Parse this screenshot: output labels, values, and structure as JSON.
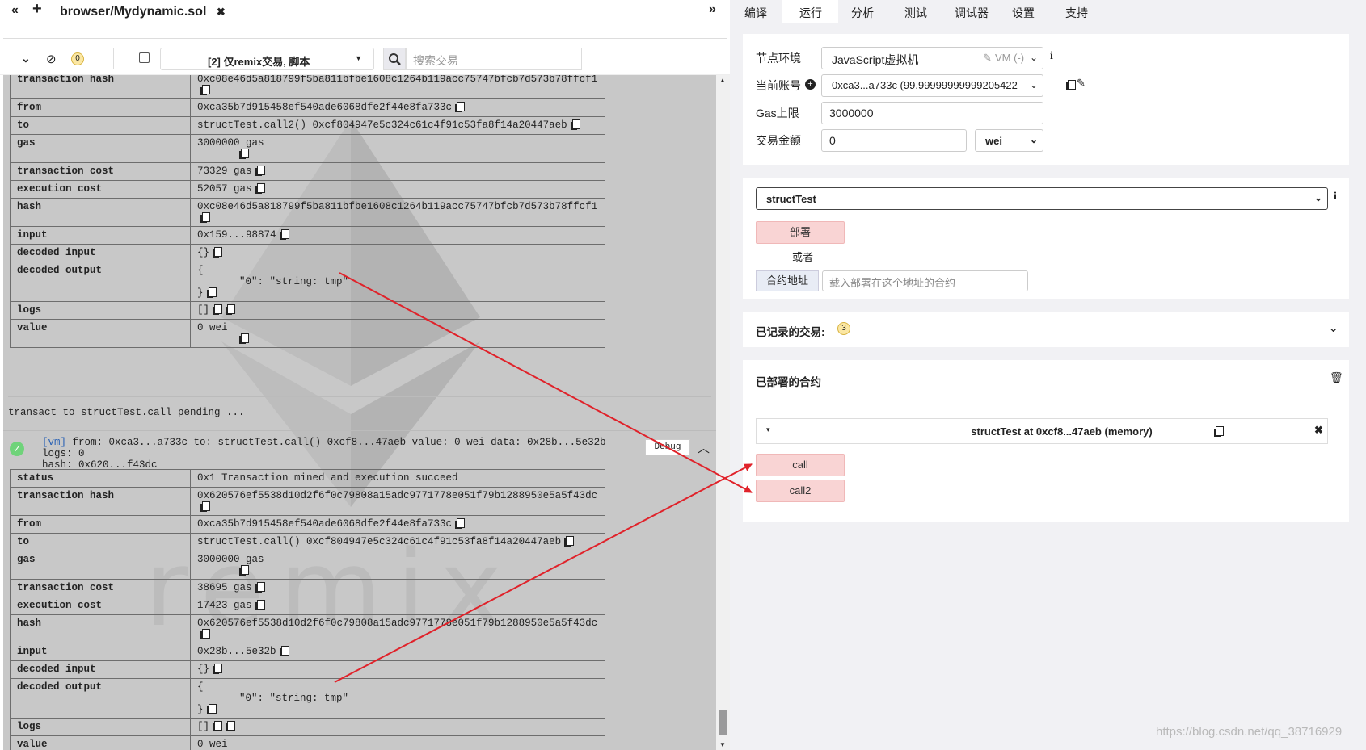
{
  "editor": {
    "collapse_icon": "«",
    "add_icon": "+",
    "file_tab": "browser/Mydynamic.sol",
    "close_icon": "✖",
    "expand_icon": "»"
  },
  "toolbar": {
    "pending_count": "0",
    "filter_label": "[2] 仅remix交易, 脚本",
    "search_placeholder": "搜索交易"
  },
  "tx1": {
    "rows": [
      {
        "k": "transaction hash",
        "v": "0xc08e46d5a818799f5ba811bfbe1608c1264b119acc75747bfcb7d573b78ffcf1"
      },
      {
        "k": "from",
        "v": "0xca35b7d915458ef540ade6068dfe2f44e8fa733c"
      },
      {
        "k": "to",
        "v": "structTest.call2() 0xcf804947e5c324c61c4f91c53fa8f14a20447aeb"
      },
      {
        "k": "gas",
        "v": "3000000 gas"
      },
      {
        "k": "transaction cost",
        "v": "73329 gas"
      },
      {
        "k": "execution cost",
        "v": "52057 gas"
      },
      {
        "k": "hash",
        "v": "0xc08e46d5a818799f5ba811bfbe1608c1264b119acc75747bfcb7d573b78ffcf1"
      },
      {
        "k": "input",
        "v": "0x159...98874"
      },
      {
        "k": "decoded input",
        "v": "{}"
      },
      {
        "k": "decoded output",
        "v": "{"
      },
      {
        "k": "logs",
        "v": "[]"
      },
      {
        "k": "value",
        "v": "0 wei"
      }
    ],
    "output_line": "\"0\": \"string: tmp\"",
    "output_close": "}"
  },
  "pending_text": "transact to structTest.call pending ...",
  "tx2_summary": {
    "vm": "[vm]",
    "line1": "from: 0xca3...a733c to: structTest.call() 0xcf8...47aeb value: 0 wei data: 0x28b...5e32b logs: 0",
    "line2": "hash: 0x620...f43dc",
    "debug": "Debug"
  },
  "tx2": {
    "rows": [
      {
        "k": "status",
        "v": "0x1 Transaction mined and execution succeed"
      },
      {
        "k": "transaction hash",
        "v": "0x620576ef5538d10d2f6f0c79808a15adc9771778e051f79b1288950e5a5f43dc"
      },
      {
        "k": "from",
        "v": "0xca35b7d915458ef540ade6068dfe2f44e8fa733c"
      },
      {
        "k": "to",
        "v": "structTest.call() 0xcf804947e5c324c61c4f91c53fa8f14a20447aeb"
      },
      {
        "k": "gas",
        "v": "3000000 gas"
      },
      {
        "k": "transaction cost",
        "v": "38695 gas"
      },
      {
        "k": "execution cost",
        "v": "17423 gas"
      },
      {
        "k": "hash",
        "v": "0x620576ef5538d10d2f6f0c79808a15adc9771778e051f79b1288950e5a5f43dc"
      },
      {
        "k": "input",
        "v": "0x28b...5e32b"
      },
      {
        "k": "decoded input",
        "v": "{}"
      },
      {
        "k": "decoded output",
        "v": "{"
      },
      {
        "k": "logs",
        "v": "[]"
      },
      {
        "k": "value",
        "v": "0 wei"
      }
    ],
    "output_line": "\"0\": \"string: tmp\"",
    "output_close": "}"
  },
  "right_tabs": [
    "编译",
    "运行",
    "分析",
    "测试",
    "调试器",
    "设置",
    "支持"
  ],
  "env": {
    "label": "节点环境",
    "value": "JavaScript虚拟机",
    "vm": "VM (-)",
    "info": "i"
  },
  "account": {
    "label": "当前账号",
    "value": "0xca3...a733c (99.99999999999205422"
  },
  "gas": {
    "label": "Gas上限",
    "value": "3000000"
  },
  "amount": {
    "label": "交易金额",
    "value": "0",
    "unit": "wei"
  },
  "contract": {
    "selected": "structTest",
    "deploy": "部署",
    "or": "或者",
    "at_address": "合约地址",
    "at_placeholder": "载入部署在这个地址的合约"
  },
  "recorded": {
    "label": "已记录的交易:",
    "count": "3"
  },
  "deployed": {
    "label": "已部署的合约",
    "instance": "structTest at 0xcf8...47aeb (memory)",
    "methods": [
      "call",
      "call2"
    ]
  },
  "watermark": "https://blog.csdn.net/qq_38716929",
  "colors": {
    "arrow": "#e0222a",
    "pink_button": "#f9d4d4",
    "terminal_bg": "#c8c8c8"
  }
}
